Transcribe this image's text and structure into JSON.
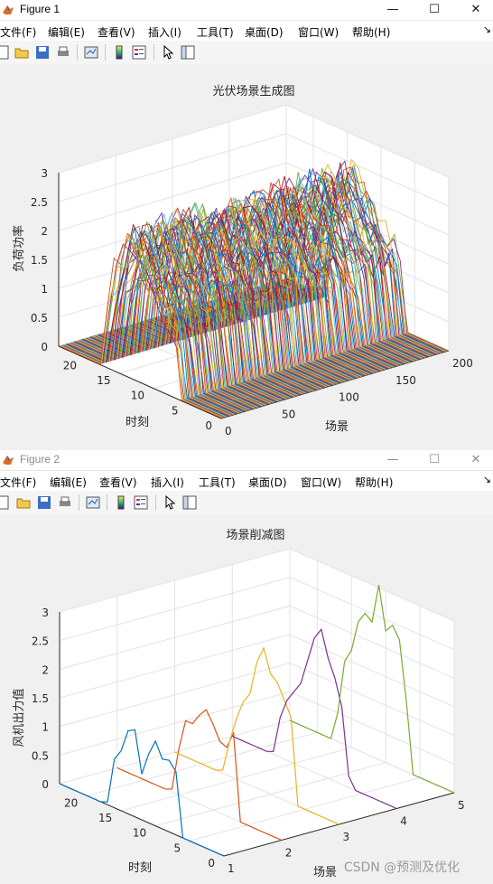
{
  "colors": [
    "#0072BD",
    "#D95319",
    "#EDB120",
    "#7E2F8E",
    "#77AC30",
    "#4DBEEE",
    "#A2142F"
  ],
  "fig1": {
    "window_title": "Figure 1",
    "menu": [
      "文件(F)",
      "编辑(E)",
      "查看(V)",
      "插入(I)",
      "工具(T)",
      "桌面(D)",
      "窗口(W)",
      "帮助(H)"
    ],
    "toolbar_icons": [
      "new-figure-icon",
      "open-file-icon",
      "save-icon",
      "print-icon",
      "link-plot-icon",
      "colorbar-icon",
      "legend-icon",
      "pointer-icon",
      "property-inspector-icon"
    ]
  },
  "fig2": {
    "window_title": "Figure 2",
    "menu": [
      "文件(F)",
      "编辑(E)",
      "查看(V)",
      "插入(I)",
      "工具(T)",
      "桌面(D)",
      "窗口(W)",
      "帮助(H)"
    ],
    "toolbar_icons": [
      "new-figure-icon",
      "open-file-icon",
      "save-icon",
      "print-icon",
      "link-plot-icon",
      "colorbar-icon",
      "legend-icon",
      "pointer-icon",
      "property-inspector-icon"
    ]
  },
  "watermark": "CSDN @预测及优化",
  "chart_data": [
    {
      "type": "line",
      "plot": "plot3",
      "title": "光伏场景生成图",
      "xlabel": "场景",
      "ylabel": "时刻",
      "zlabel": "负荷功率",
      "xlim": [
        0,
        200
      ],
      "ylim": [
        0,
        24
      ],
      "zlim": [
        0,
        3
      ],
      "xticks": [
        0,
        50,
        100,
        150,
        200
      ],
      "yticks": [
        0,
        5,
        10,
        15,
        20
      ],
      "zticks": [
        0,
        0.5,
        1,
        1.5,
        2,
        2.5,
        3
      ],
      "grid": true,
      "series_count": 200,
      "profile_hours": [
        0,
        1,
        2,
        3,
        4,
        5,
        6,
        7,
        8,
        9,
        10,
        11,
        12,
        13,
        14,
        15,
        16,
        17,
        18,
        19,
        20,
        21,
        22,
        23,
        24
      ],
      "profile_mean": [
        0,
        0,
        0,
        0,
        0,
        0,
        0,
        1.1,
        1.3,
        1.5,
        1.6,
        1.8,
        2.0,
        2.2,
        2.3,
        2.1,
        1.6,
        1.1,
        0,
        0,
        0,
        0,
        0,
        0,
        0
      ],
      "noise": 0.35
    },
    {
      "type": "line",
      "plot": "plot3",
      "title": "场景削减图",
      "xlabel": "场景",
      "ylabel": "时刻",
      "zlabel": "风机出力值",
      "xlim": [
        1,
        5
      ],
      "ylim": [
        0,
        24
      ],
      "zlim": [
        0,
        3
      ],
      "xticks": [
        1,
        2,
        3,
        4,
        5
      ],
      "yticks": [
        0,
        5,
        10,
        15,
        20
      ],
      "zticks": [
        0,
        0.5,
        1,
        1.5,
        2,
        2.5,
        3
      ],
      "grid": true,
      "hours": [
        0,
        1,
        2,
        3,
        4,
        5,
        6,
        7,
        8,
        9,
        10,
        11,
        12,
        13,
        14,
        15,
        16,
        17,
        18,
        19,
        20,
        21,
        22,
        23,
        24
      ],
      "series": [
        {
          "x": 1,
          "values": [
            0,
            0,
            0,
            0,
            0,
            0,
            0,
            1.1,
            1.25,
            1.22,
            1.48,
            1.2,
            0.8,
            1.52,
            1.45,
            1.05,
            0.85,
            0.05,
            0,
            0,
            0,
            0,
            0,
            0,
            0
          ]
        },
        {
          "x": 2,
          "values": [
            0,
            0,
            0,
            0,
            0,
            0,
            0,
            1.5,
            1.2,
            1.25,
            1.5,
            1.7,
            1.55,
            1.35,
            1.35,
            0.8,
            0.05,
            0,
            0,
            0,
            0,
            0,
            0,
            0,
            0
          ]
        },
        {
          "x": 3,
          "values": [
            0,
            0,
            0,
            0,
            0,
            0,
            0,
            1.5,
            1.75,
            2.0,
            2.1,
            2.5,
            2.2,
            1.6,
            1.4,
            1.05,
            0.6,
            0.05,
            0,
            0,
            0,
            0,
            0,
            0,
            0
          ]
        },
        {
          "x": 4,
          "values": [
            0,
            0,
            0,
            0,
            0,
            0,
            0,
            0.2,
            1.35,
            1.8,
            2.1,
            2.55,
            2.35,
            1.9,
            1.45,
            1.25,
            1.05,
            0.7,
            0.05,
            0,
            0,
            0,
            0,
            0,
            0
          ]
        },
        {
          "x": 5,
          "values": [
            0,
            0,
            0,
            0,
            0,
            0,
            0,
            1.25,
            2.25,
            2.45,
            2.3,
            3.05,
            2.35,
            2.45,
            2.25,
            1.7,
            1.45,
            0.5,
            0,
            0,
            0,
            0,
            0,
            0,
            0
          ]
        }
      ]
    }
  ]
}
